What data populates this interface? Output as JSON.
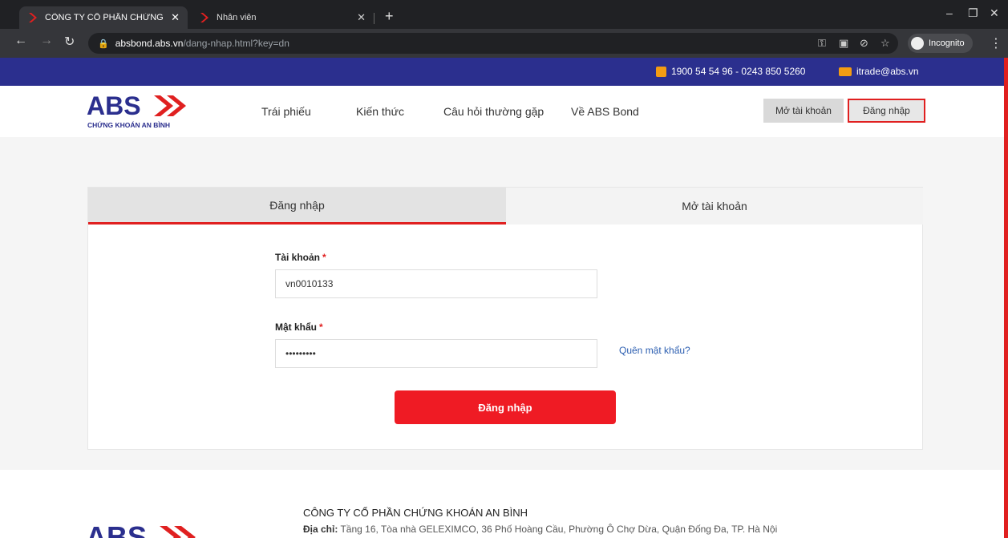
{
  "browser": {
    "tabs": [
      {
        "title": "CÔNG TY CỔ PHẦN CHỨNG KHC",
        "active": true
      },
      {
        "title": "Nhân viên",
        "active": false
      }
    ],
    "url_host": "absbond.abs.vn",
    "url_path": "/dang-nhap.html?key=dn",
    "incognito_label": "Incognito"
  },
  "topbar": {
    "phone": "1900 54 54 96 - 0243 850 5260",
    "email": "itrade@abs.vn"
  },
  "header": {
    "logo_text": "ABS",
    "logo_sub": "CHỨNG KHOÁN AN BÌNH",
    "nav": [
      "Trái phiếu",
      "Kiến thức",
      "Câu hỏi thường gặp",
      "Về ABS Bond"
    ],
    "open_account": "Mở tài khoản",
    "login": "Đăng nhập"
  },
  "form": {
    "tabs": [
      "Đăng nhập",
      "Mở tài khoản"
    ],
    "account_label": "Tài khoản",
    "account_value": "vn0010133",
    "password_label": "Mật khẩu",
    "password_value": "•••••••••",
    "required_mark": "*",
    "forgot": "Quên mật khẩu?",
    "submit": "Đăng nhập"
  },
  "footer": {
    "company": "CÔNG TY CỔ PHẦN CHỨNG KHOÁN AN BÌNH",
    "address_label": "Địa chỉ:",
    "address": "Tầng 16, Tòa nhà GELEXIMCO, 36 Phố Hoàng Cầu, Phường Ô Chợ Dừa, Quận Đống Đa, TP. Hà Nội"
  },
  "colors": {
    "brand_blue": "#2b2f8e",
    "brand_red": "#ef1b24"
  }
}
